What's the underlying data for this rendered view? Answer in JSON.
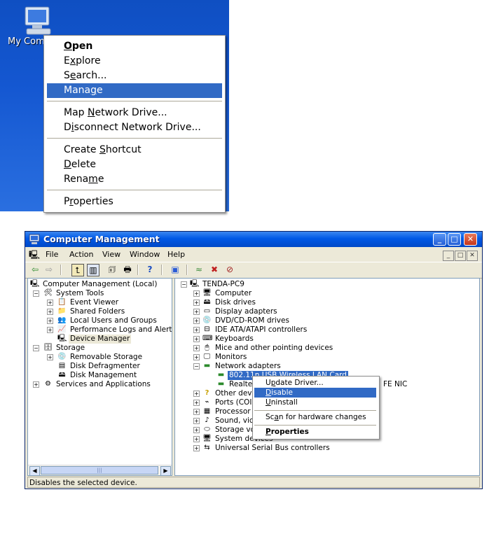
{
  "desktop": {
    "icon": "my-computer-icon",
    "icon_label": "My Com"
  },
  "context_menu": {
    "items": [
      {
        "label": "Open",
        "bold": true
      },
      {
        "label": "Explore"
      },
      {
        "label": "Search..."
      },
      {
        "label": "Manage",
        "selected": true
      },
      {
        "label": "Map Network Drive..."
      },
      {
        "label": "Disconnect Network Drive..."
      },
      {
        "label": "Create Shortcut"
      },
      {
        "label": "Delete"
      },
      {
        "label": "Rename"
      },
      {
        "label": "Properties"
      }
    ],
    "selection_color": "#316ac5"
  },
  "window": {
    "title": "Computer Management",
    "title_icon": "computer-management-icon",
    "controls": [
      "_",
      "□",
      "✕"
    ],
    "menu": [
      "File",
      "Action",
      "View",
      "Window",
      "Help"
    ],
    "mdi_controls": [
      "_",
      "□",
      "✕"
    ],
    "toolbar_icons": [
      "back-arrow-icon",
      "forward-arrow-icon",
      "up-folder-icon",
      "show-hide-tree-icon",
      "properties-icon",
      "print-icon",
      "help-icon",
      "scan-hardware-icon",
      "update-driver-icon",
      "uninstall-icon",
      "disable-device-icon"
    ],
    "left_tree": [
      {
        "label": "Computer Management (Local)",
        "icon": "computer-management-icon",
        "expander": "−"
      },
      {
        "label": "System Tools",
        "icon": "system-tools-icon",
        "expander": "−"
      },
      {
        "label": "Event Viewer",
        "icon": "event-viewer-icon",
        "expander": "+"
      },
      {
        "label": "Shared Folders",
        "icon": "shared-folders-icon",
        "expander": "+"
      },
      {
        "label": "Local Users and Groups",
        "icon": "users-icon",
        "expander": "+"
      },
      {
        "label": "Performance Logs and Alerts",
        "icon": "performance-icon",
        "expander": "+"
      },
      {
        "label": "Device Manager",
        "icon": "device-manager-icon",
        "expander": ""
      },
      {
        "label": "Storage",
        "icon": "storage-icon",
        "expander": "−"
      },
      {
        "label": "Removable Storage",
        "icon": "removable-storage-icon",
        "expander": "+"
      },
      {
        "label": "Disk Defragmenter",
        "icon": "defragmenter-icon",
        "expander": ""
      },
      {
        "label": "Disk Management",
        "icon": "disk-management-icon",
        "expander": ""
      },
      {
        "label": "Services and Applications",
        "icon": "services-icon",
        "expander": "+"
      }
    ],
    "right_tree": [
      {
        "label": "TENDA-PC9",
        "icon": "computer-icon",
        "expander": "−"
      },
      {
        "label": "Computer",
        "icon": "computer-icon",
        "expander": "+"
      },
      {
        "label": "Disk drives",
        "icon": "disk-drive-icon",
        "expander": "+"
      },
      {
        "label": "Display adapters",
        "icon": "display-adapter-icon",
        "expander": "+"
      },
      {
        "label": "DVD/CD-ROM drives",
        "icon": "dvd-drive-icon",
        "expander": "+"
      },
      {
        "label": "IDE ATA/ATAPI controllers",
        "icon": "ide-controller-icon",
        "expander": "+"
      },
      {
        "label": "Keyboards",
        "icon": "keyboard-icon",
        "expander": "+"
      },
      {
        "label": "Mice and other pointing devices",
        "icon": "mouse-icon",
        "expander": "+"
      },
      {
        "label": "Monitors",
        "icon": "monitor-icon",
        "expander": "+"
      },
      {
        "label": "Network adapters",
        "icon": "network-adapter-icon",
        "expander": "−"
      },
      {
        "label": "802.11n USB Wireless LAN Card",
        "icon": "network-card-icon",
        "expander": "",
        "selected": true
      },
      {
        "label": "Realte",
        "icon": "network-card-icon",
        "expander": "",
        "suffix": "FE NIC"
      },
      {
        "label": "Other dev",
        "icon": "other-devices-icon",
        "expander": "+"
      },
      {
        "label": "Ports (COI",
        "icon": "ports-icon",
        "expander": "+"
      },
      {
        "label": "Processor",
        "icon": "processor-icon",
        "expander": "+"
      },
      {
        "label": "Sound, vic",
        "icon": "sound-icon",
        "expander": "+"
      },
      {
        "label": "Storage vo",
        "icon": "storage-volume-icon",
        "expander": "+"
      },
      {
        "label": "System devices",
        "icon": "system-devices-icon",
        "expander": "+"
      },
      {
        "label": "Universal Serial Bus controllers",
        "icon": "usb-icon",
        "expander": "+"
      }
    ],
    "device_context_menu": [
      {
        "label": "Update Driver..."
      },
      {
        "label": "Disable",
        "selected": true
      },
      {
        "label": "Uninstall"
      },
      {
        "label": "Scan for hardware changes"
      },
      {
        "label": "Properties",
        "bold": true
      }
    ],
    "status_text": "Disables the selected device.",
    "scrollbar_thumb": "|||",
    "colors": {
      "titlebar": "#0058e6",
      "frame": "#ece9d8",
      "selection": "#316ac5"
    }
  }
}
